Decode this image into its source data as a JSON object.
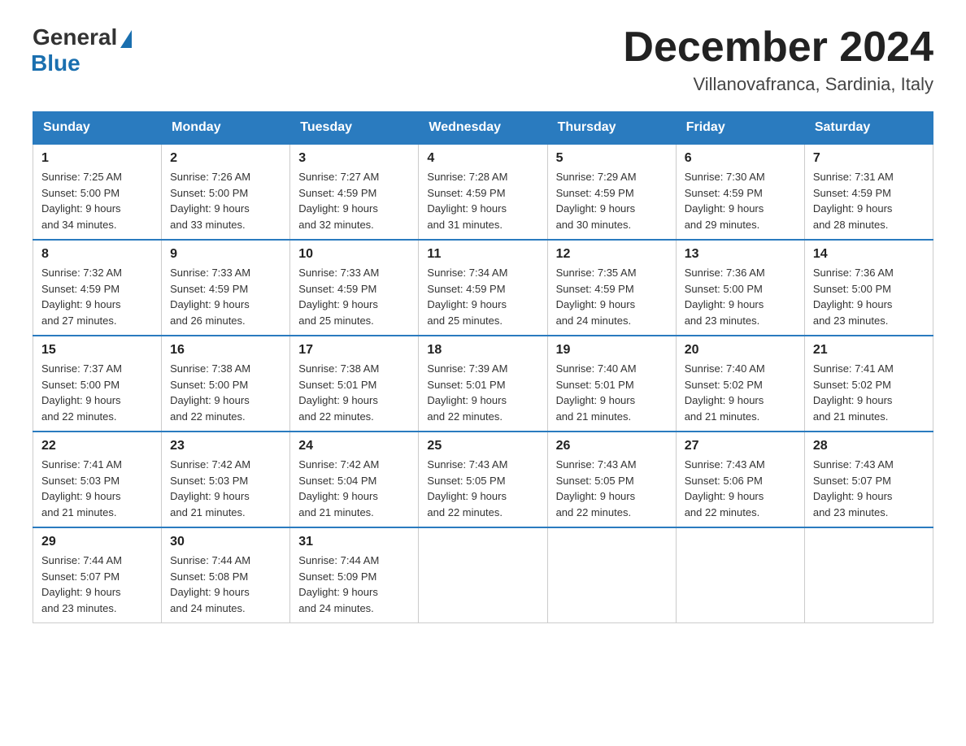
{
  "logo": {
    "general": "General",
    "blue": "Blue"
  },
  "title": {
    "month_year": "December 2024",
    "location": "Villanovafranca, Sardinia, Italy"
  },
  "headers": [
    "Sunday",
    "Monday",
    "Tuesday",
    "Wednesday",
    "Thursday",
    "Friday",
    "Saturday"
  ],
  "weeks": [
    [
      {
        "day": "1",
        "sunrise": "7:25 AM",
        "sunset": "5:00 PM",
        "daylight": "9 hours and 34 minutes."
      },
      {
        "day": "2",
        "sunrise": "7:26 AM",
        "sunset": "5:00 PM",
        "daylight": "9 hours and 33 minutes."
      },
      {
        "day": "3",
        "sunrise": "7:27 AM",
        "sunset": "4:59 PM",
        "daylight": "9 hours and 32 minutes."
      },
      {
        "day": "4",
        "sunrise": "7:28 AM",
        "sunset": "4:59 PM",
        "daylight": "9 hours and 31 minutes."
      },
      {
        "day": "5",
        "sunrise": "7:29 AM",
        "sunset": "4:59 PM",
        "daylight": "9 hours and 30 minutes."
      },
      {
        "day": "6",
        "sunrise": "7:30 AM",
        "sunset": "4:59 PM",
        "daylight": "9 hours and 29 minutes."
      },
      {
        "day": "7",
        "sunrise": "7:31 AM",
        "sunset": "4:59 PM",
        "daylight": "9 hours and 28 minutes."
      }
    ],
    [
      {
        "day": "8",
        "sunrise": "7:32 AM",
        "sunset": "4:59 PM",
        "daylight": "9 hours and 27 minutes."
      },
      {
        "day": "9",
        "sunrise": "7:33 AM",
        "sunset": "4:59 PM",
        "daylight": "9 hours and 26 minutes."
      },
      {
        "day": "10",
        "sunrise": "7:33 AM",
        "sunset": "4:59 PM",
        "daylight": "9 hours and 25 minutes."
      },
      {
        "day": "11",
        "sunrise": "7:34 AM",
        "sunset": "4:59 PM",
        "daylight": "9 hours and 25 minutes."
      },
      {
        "day": "12",
        "sunrise": "7:35 AM",
        "sunset": "4:59 PM",
        "daylight": "9 hours and 24 minutes."
      },
      {
        "day": "13",
        "sunrise": "7:36 AM",
        "sunset": "5:00 PM",
        "daylight": "9 hours and 23 minutes."
      },
      {
        "day": "14",
        "sunrise": "7:36 AM",
        "sunset": "5:00 PM",
        "daylight": "9 hours and 23 minutes."
      }
    ],
    [
      {
        "day": "15",
        "sunrise": "7:37 AM",
        "sunset": "5:00 PM",
        "daylight": "9 hours and 22 minutes."
      },
      {
        "day": "16",
        "sunrise": "7:38 AM",
        "sunset": "5:00 PM",
        "daylight": "9 hours and 22 minutes."
      },
      {
        "day": "17",
        "sunrise": "7:38 AM",
        "sunset": "5:01 PM",
        "daylight": "9 hours and 22 minutes."
      },
      {
        "day": "18",
        "sunrise": "7:39 AM",
        "sunset": "5:01 PM",
        "daylight": "9 hours and 22 minutes."
      },
      {
        "day": "19",
        "sunrise": "7:40 AM",
        "sunset": "5:01 PM",
        "daylight": "9 hours and 21 minutes."
      },
      {
        "day": "20",
        "sunrise": "7:40 AM",
        "sunset": "5:02 PM",
        "daylight": "9 hours and 21 minutes."
      },
      {
        "day": "21",
        "sunrise": "7:41 AM",
        "sunset": "5:02 PM",
        "daylight": "9 hours and 21 minutes."
      }
    ],
    [
      {
        "day": "22",
        "sunrise": "7:41 AM",
        "sunset": "5:03 PM",
        "daylight": "9 hours and 21 minutes."
      },
      {
        "day": "23",
        "sunrise": "7:42 AM",
        "sunset": "5:03 PM",
        "daylight": "9 hours and 21 minutes."
      },
      {
        "day": "24",
        "sunrise": "7:42 AM",
        "sunset": "5:04 PM",
        "daylight": "9 hours and 21 minutes."
      },
      {
        "day": "25",
        "sunrise": "7:43 AM",
        "sunset": "5:05 PM",
        "daylight": "9 hours and 22 minutes."
      },
      {
        "day": "26",
        "sunrise": "7:43 AM",
        "sunset": "5:05 PM",
        "daylight": "9 hours and 22 minutes."
      },
      {
        "day": "27",
        "sunrise": "7:43 AM",
        "sunset": "5:06 PM",
        "daylight": "9 hours and 22 minutes."
      },
      {
        "day": "28",
        "sunrise": "7:43 AM",
        "sunset": "5:07 PM",
        "daylight": "9 hours and 23 minutes."
      }
    ],
    [
      {
        "day": "29",
        "sunrise": "7:44 AM",
        "sunset": "5:07 PM",
        "daylight": "9 hours and 23 minutes."
      },
      {
        "day": "30",
        "sunrise": "7:44 AM",
        "sunset": "5:08 PM",
        "daylight": "9 hours and 24 minutes."
      },
      {
        "day": "31",
        "sunrise": "7:44 AM",
        "sunset": "5:09 PM",
        "daylight": "9 hours and 24 minutes."
      },
      null,
      null,
      null,
      null
    ]
  ],
  "labels": {
    "sunrise": "Sunrise:",
    "sunset": "Sunset:",
    "daylight": "Daylight:"
  }
}
